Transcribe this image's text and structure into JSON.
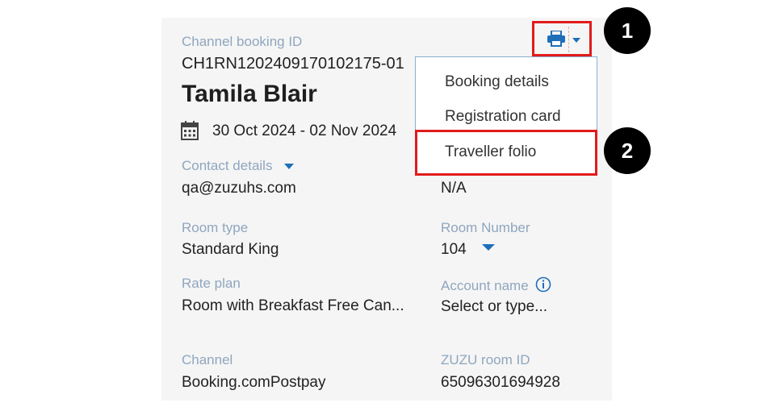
{
  "booking": {
    "channel_booking_id_label": "Channel booking ID",
    "channel_booking_id": "CH1RN1202409170102175-01",
    "guest_name": "Tamila Blair",
    "date_range": "30 Oct 2024 - 02 Nov 2024",
    "contact_details_label": "Contact details",
    "contact_email": "qa@zuzuhs.com",
    "contact_right_value": "N/A",
    "room_type_label": "Room type",
    "room_type": "Standard King",
    "room_number_label": "Room Number",
    "room_number": "104",
    "rate_plan_label": "Rate plan",
    "rate_plan": "Room with Breakfast Free Can...",
    "account_name_label": "Account name",
    "account_name_placeholder": "Select or type...",
    "channel_label": "Channel",
    "channel": "Booking.comPostpay",
    "zuzu_room_id_label": "ZUZU room ID",
    "zuzu_room_id": "65096301694928"
  },
  "print_menu": {
    "items": [
      "Booking details",
      "Registration card",
      "Traveller folio"
    ]
  },
  "annotations": {
    "step1": "1",
    "step2": "2"
  },
  "colors": {
    "accent": "#1e6fb8",
    "label": "#8fa6bf",
    "highlight": "#e11b1b"
  },
  "icons": [
    "calendar-icon",
    "printer-icon",
    "chevron-down-icon",
    "info-icon"
  ]
}
